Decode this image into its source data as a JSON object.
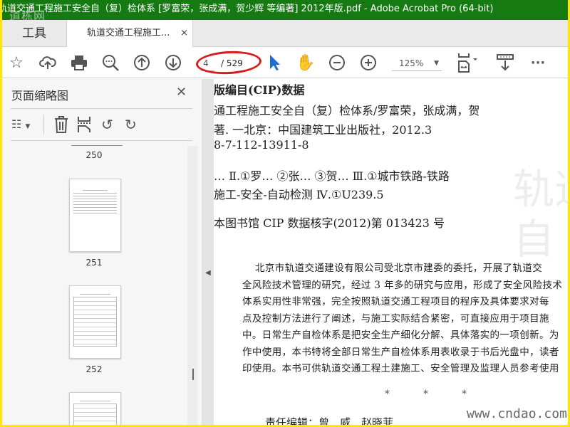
{
  "window": {
    "title": "轨道交通工程施工安全自（复）检体系 [罗富荣，张成满，贺少辉 等编著] 2012年版.pdf - Adobe Acrobat Pro (64-bit)",
    "watermark": "道栋网"
  },
  "tabs": {
    "tools": "工具",
    "document": "轨道交通工程施工...",
    "close": "×"
  },
  "toolbar": {
    "page_current": "4",
    "page_total": "/ 529",
    "zoom": "125%",
    "icons": [
      "star-icon",
      "cloud-upload-icon",
      "print-icon",
      "find-icon",
      "arrow-up-icon",
      "arrow-down-icon",
      "select-cursor-icon",
      "hand-icon",
      "zoom-out-icon",
      "zoom-in-icon",
      "fit-page-icon",
      "scan-icon",
      "more-icon"
    ]
  },
  "colors": {
    "titlebar": "#157a12",
    "annotation": "#d91b1b",
    "cursor": "#1f6fd1"
  },
  "sidebar": {
    "title": "页面缩略图",
    "close": "✕",
    "thumbnails": [
      {
        "label": "250"
      },
      {
        "label": "251"
      },
      {
        "label": "252"
      }
    ]
  },
  "document": {
    "lines": [
      "版编目(CIP)数据",
      "通工程施工安全自（复）检体系/罗富荣，张成满，贺",
      "著. 一北京：中国建筑工业出版社，2012.3",
      "8-7-112-13911-8",
      "…   Ⅱ.①罗… ②张… ③贺…   Ⅲ.①城市铁路-铁路",
      "施工-安全-自动检测   Ⅳ.①U239.5",
      "本图书馆 CIP 数据核字(2012)第 013423 号"
    ],
    "paragraph": [
      "北京市轨道交通建设有限公司受北京市建委的委托，开展了轨道交",
      "全风险技术管理的研究，经过 3 年多的研究与应用，形成了安全风险技术",
      "体系实用性非常强，完全按照轨道交通工程项目的程序及具体要求对每",
      "点及控制方法进行了阐述，与施工实际结合紧密，可直接应用于项目施",
      "中。日常生产自检体系是把安全生产细化分解、具体落实的一项创新。为",
      "作中使用，本书特将全部日常生产自检体系用表收录于书后光盘中，读者",
      "印使用。本书可供轨道交通工程土建施工、安全管理及监理人员参考使用"
    ],
    "stars": "*          *          *",
    "editor": "责任编辑：曾　威　赵晓菲",
    "site_watermark": "www.cndao.com",
    "ghost_text": "轨道交通工程施工安全\n自（复）检体系"
  }
}
